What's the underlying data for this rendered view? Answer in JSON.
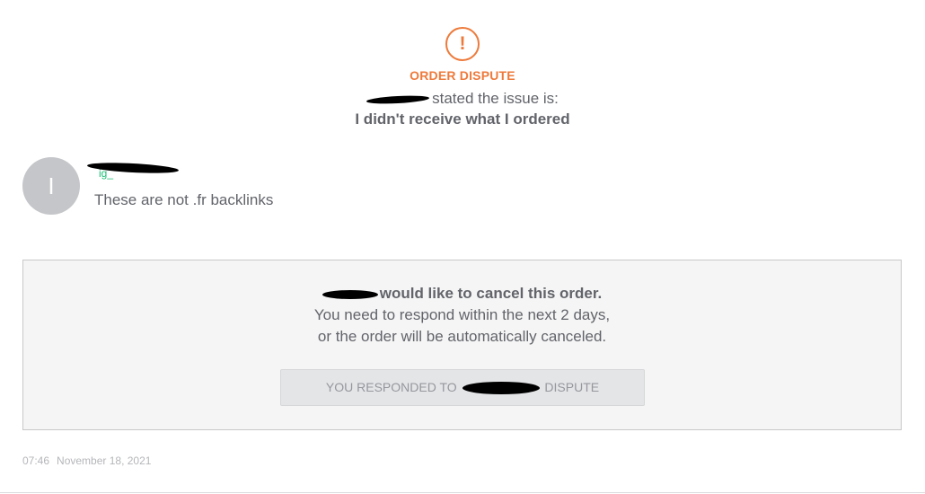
{
  "dispute": {
    "icon": "alert-circle-icon",
    "title": "ORDER DISPUTE",
    "stated_suffix": "stated the issue is:",
    "issue": "I didn't receive what I ordered"
  },
  "message": {
    "avatar_initial": "I",
    "sender_visible": "ig_",
    "text": "These are not .fr backlinks"
  },
  "cancel_request": {
    "title_suffix": "would like to cancel this order.",
    "line1": "You need to respond within the next 2 days,",
    "line2": "or the order will be automatically canceled.",
    "button_prefix": "YOU RESPONDED TO",
    "button_suffix": "DISPUTE"
  },
  "timestamp": {
    "time": "07:46",
    "date": "November 18, 2021"
  },
  "colors": {
    "accent": "#ed7a3b",
    "sender_green": "#1dbf73",
    "text": "#62646a"
  }
}
